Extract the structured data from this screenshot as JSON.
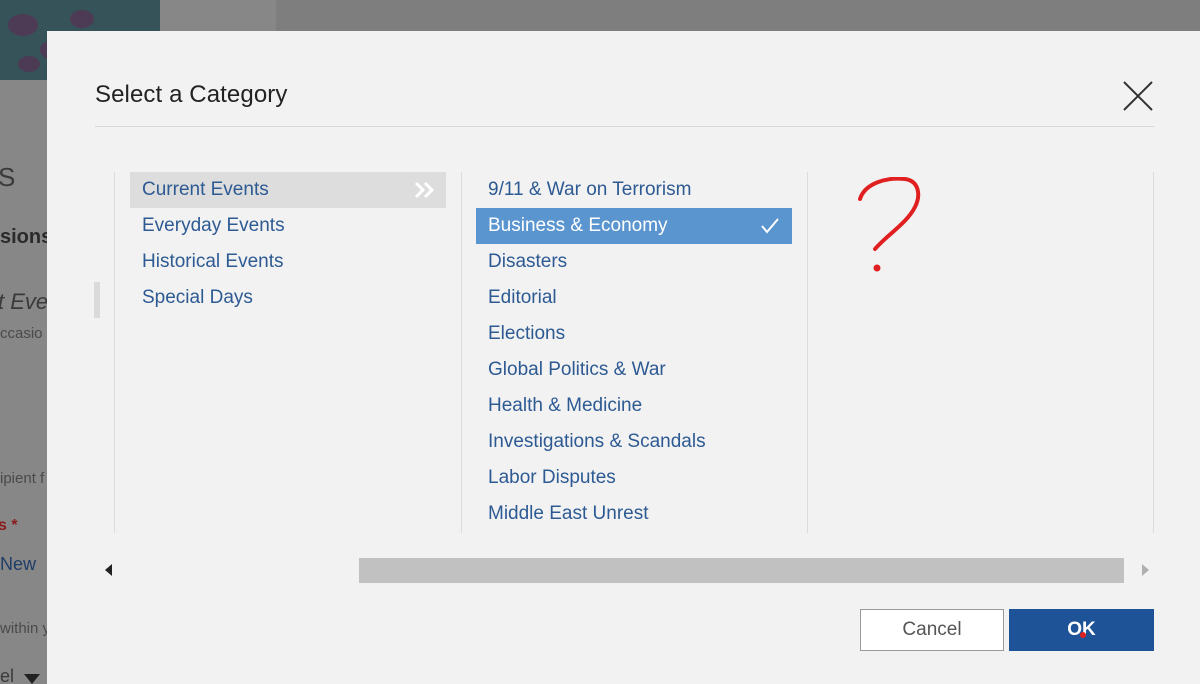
{
  "background": {
    "fragments": [
      "S",
      "sions",
      "t Eve",
      "ccasio",
      "ipient f",
      "s *",
      "New",
      "within y",
      "el"
    ]
  },
  "dialog": {
    "title": "Select a Category",
    "categories": [
      {
        "label": "Current Events"
      },
      {
        "label": "Everyday Events"
      },
      {
        "label": "Historical Events"
      },
      {
        "label": "Special Days"
      }
    ],
    "active_category_index": 0,
    "subcategories": [
      {
        "label": "9/11 & War on Terrorism"
      },
      {
        "label": "Business & Economy"
      },
      {
        "label": "Disasters"
      },
      {
        "label": "Editorial"
      },
      {
        "label": "Elections"
      },
      {
        "label": "Global Politics & War"
      },
      {
        "label": "Health & Medicine"
      },
      {
        "label": "Investigations & Scandals"
      },
      {
        "label": "Labor Disputes"
      },
      {
        "label": "Middle East Unrest"
      }
    ],
    "selected_subcategory_index": 1,
    "horizontal_scroll_position": 0.25,
    "buttons": {
      "cancel": "Cancel",
      "ok": "OK"
    }
  },
  "annotation": {
    "mark": "question-mark",
    "color": "#e02020"
  },
  "colors": {
    "link_blue": "#2d5a93",
    "selected_bg": "#5b95cf",
    "ok_button": "#1f5397"
  },
  "icons": {
    "close": "close-icon",
    "expand": "double-chevron-right-icon",
    "check": "checkmark-icon",
    "scroll_left": "triangle-left-icon",
    "scroll_right": "triangle-right-icon"
  }
}
